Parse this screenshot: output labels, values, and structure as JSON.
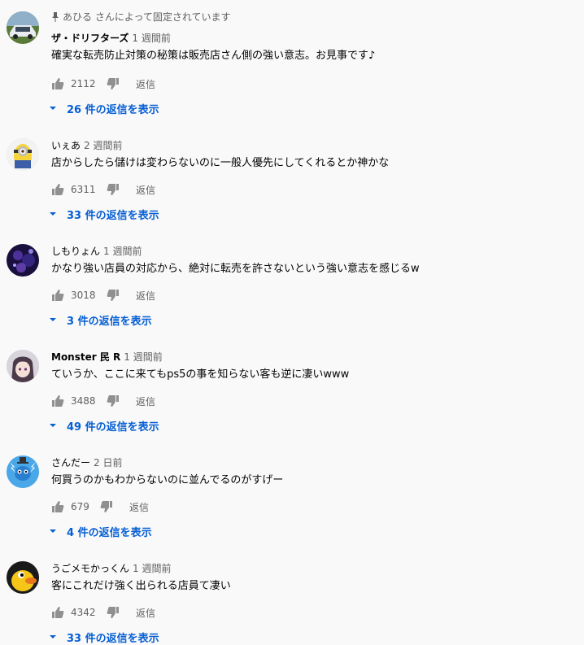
{
  "comments": [
    {
      "pinned": "あひる さんによって固定されています",
      "author": "ザ・ドリフターズ",
      "time": "1 週間前",
      "text": "確実な転売防止対策の秘策は販売店さん側の強い意志。お見事です♪",
      "likes": "2112",
      "reply": "返信",
      "replies": "26 件の返信を表示",
      "avatar": "car"
    },
    {
      "author": "いぇあ",
      "time": "2 週間前",
      "text": "店からしたら儲けは変わらないのに一般人優先にしてくれるとか神かな",
      "likes": "6311",
      "reply": "返信",
      "replies": "33 件の返信を表示",
      "avatar": "minion"
    },
    {
      "author": "しもりょん",
      "time": "1 週間前",
      "text": "かなり強い店員の対応から、絶対に転売を許さないという強い意志を感じるw",
      "likes": "3018",
      "reply": "返信",
      "replies": "3 件の返信を表示",
      "avatar": "purple"
    },
    {
      "author": "Monster 民 R",
      "time": "1 週間前",
      "text": "ていうか、ここに来てもps5の事を知らない客も逆に凄いwww",
      "likes": "3488",
      "reply": "返信",
      "replies": "49 件の返信を表示",
      "avatar": "anime"
    },
    {
      "author": "さんだー",
      "time": "2 日前",
      "text": "何買うのかもわからないのに並んでるのがすげー",
      "likes": "679",
      "reply": "返信",
      "replies": "4 件の返信を表示",
      "avatar": "thunder"
    },
    {
      "author": "うごメモかっくん",
      "time": "1 週間前",
      "text": "客にこれだけ強く出られる店員て凄い",
      "likes": "4342",
      "reply": "返信",
      "replies": "33 件の返信を表示",
      "avatar": "duck"
    }
  ],
  "colors": {
    "link": "#065fd4",
    "secondary": "#606060",
    "background": "#f9f9f9"
  },
  "icons": {
    "like": "thumb-up-icon",
    "dislike": "thumb-down-icon",
    "pin": "pin-icon",
    "expand": "caret-down-icon"
  }
}
